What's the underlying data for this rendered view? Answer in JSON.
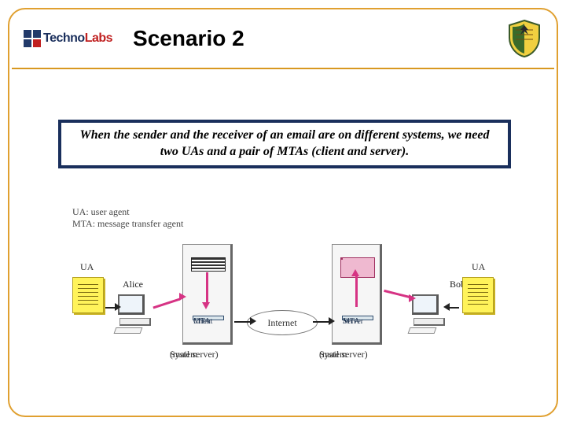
{
  "header": {
    "brand_primary": "Techno",
    "brand_secondary": "Labs",
    "title": "Scenario 2"
  },
  "caption": "When the sender and the receiver of an email are on different systems, we need two UAs and a pair of MTAs (client and server).",
  "legend": {
    "ua": "UA: user agent",
    "mta": "MTA: message transfer agent"
  },
  "diagram": {
    "left_user": "Alice",
    "right_user": "Bob",
    "ua_label": "UA",
    "mta_client_l1": "MTA",
    "mta_client_l2": "Client",
    "mta_server_l1": "MTA",
    "mta_server_l2": "Server",
    "internet": "Internet",
    "server_caption_l1": "System",
    "server_caption_l2": "(mail server)"
  }
}
